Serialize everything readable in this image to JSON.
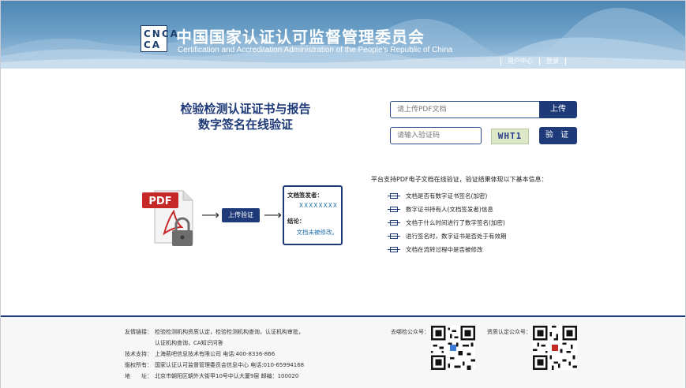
{
  "header": {
    "logo_line1": "CNCA",
    "logo_line2": "CA",
    "title": "中国国家认证认可监督管理委员会",
    "subtitle": "Certification and Accreditation  Administration of the People's Republic of China",
    "links": [
      "用户中心",
      "登录"
    ]
  },
  "main": {
    "headline_line1": "检验检测认证证书与报告",
    "headline_line2": "数字签名在线验证",
    "upload_placeholder": "请上传PDF文档",
    "upload_button": "上传",
    "captcha_placeholder": "请输入验证码",
    "captcha_text": "WHT1",
    "verify_button": "验 证"
  },
  "flow": {
    "pdf_label": "PDF",
    "upload_step": "上传验证",
    "signer_label": "文档签发者：",
    "signer_value": "XXXXXXXX",
    "conclusion_label": "结论：",
    "conclusion_value": "文档未被修改。"
  },
  "info": {
    "intro": "平台支持PDF电子文档在线验证，验证结果体现以下基本信息：",
    "items": [
      "文档是否有数字证书签名(加密)",
      "数字证书持有人(文档签发者)信息",
      "文档于什么时间进行了数字签名(加密)",
      "进行签名时，数字证书是否处于有效期",
      "文档在流转过程中是否被修改"
    ]
  },
  "footer": {
    "rows": [
      {
        "label": "友情链接：",
        "value": "检验检测机构资质认定，检验检测机构查询，认证机构审批，"
      },
      {
        "label": "",
        "value": "认证机构查询，CA知识问答"
      },
      {
        "label": "技术支持：",
        "value": "上海莂吧信息技术有限公司 电话:400-8336-866"
      },
      {
        "label": "版权所有：",
        "value": "国家认证认可监督管理委员会信息中心 电话:010-65994168"
      },
      {
        "label": "地　　址：",
        "value": "北京市朝阳区朝外大街甲10号中认大厦9层 邮编：100020"
      }
    ],
    "qr1_label": "去哪检公众号：",
    "qr2_label": "资质认定公众号："
  },
  "colors": {
    "brand": "#1f3a78",
    "header_top": "#4d86b4",
    "header_bottom": "#a7c8e2"
  }
}
